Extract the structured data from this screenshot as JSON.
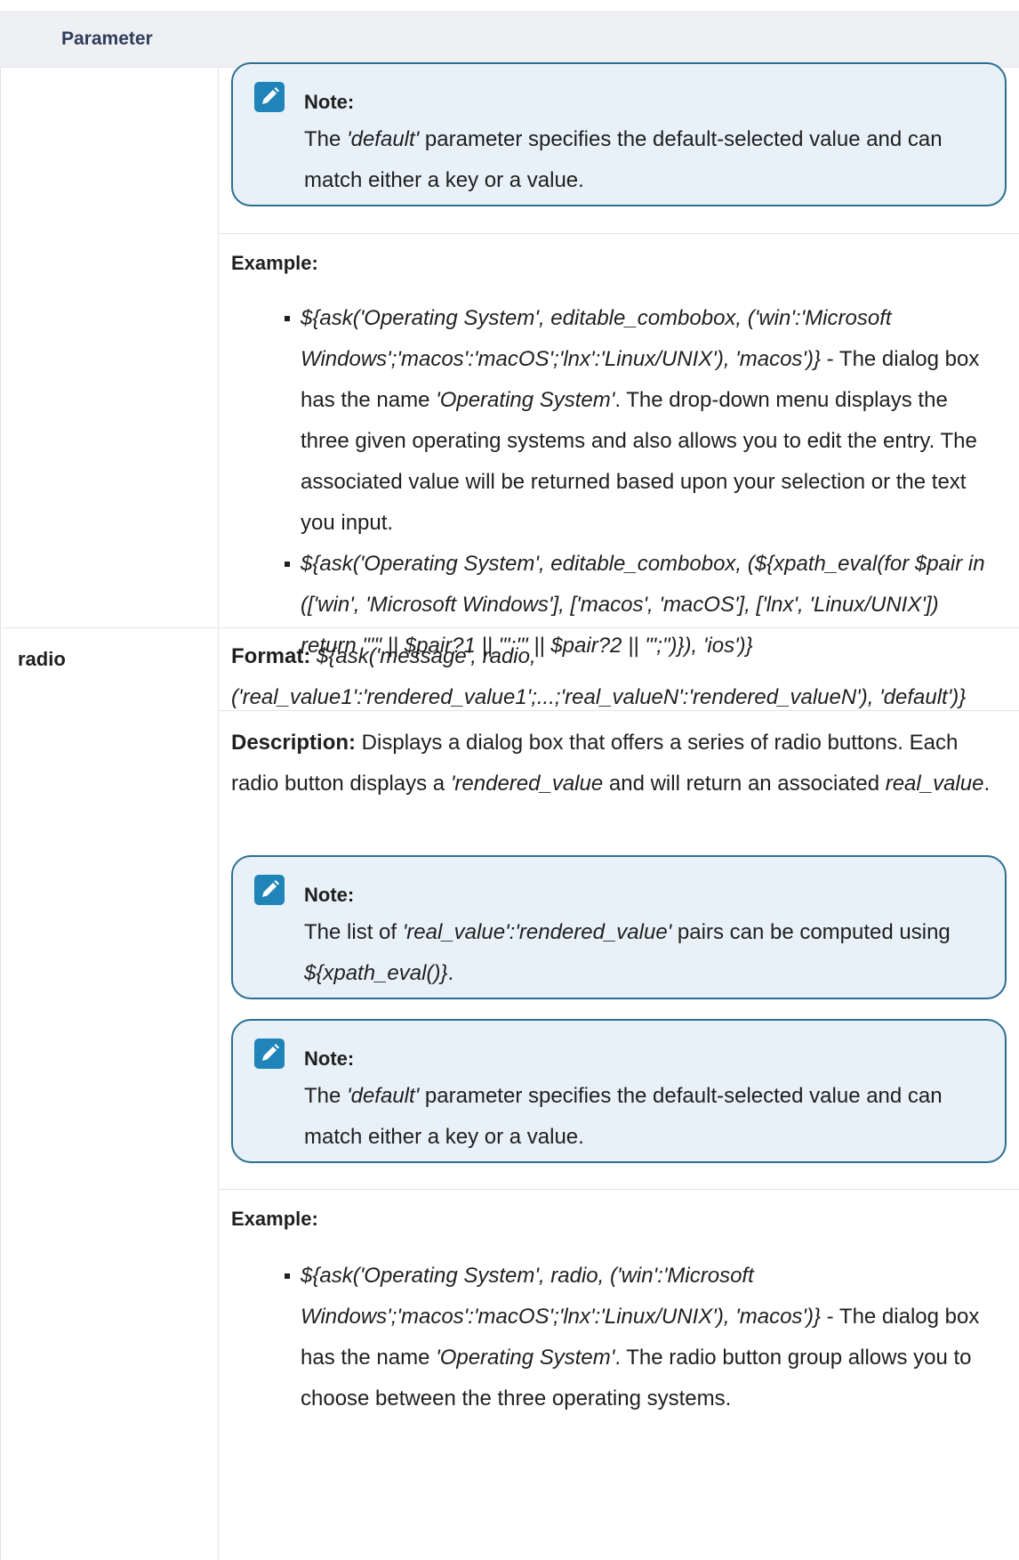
{
  "table": {
    "header": {
      "parameter": "Parameter"
    }
  },
  "note1": {
    "title": "Note:",
    "pre": "The ",
    "em": "'default'",
    "post": " parameter specifies the default-selected value and can match either a key or a value."
  },
  "example1": {
    "label": "Example:",
    "item1": {
      "code": "${ask('Operating System', editable_combobox, ('win':'Microsoft Windows';'macos':'macOS';'lnx':'Linux/UNIX'), 'macos')}",
      "t1": " - The dialog box has the name ",
      "name": "'Operating System'",
      "t2": ". The drop-down menu displays the three given operating systems and also allows you to edit the entry. The associated value will be returned based upon your selection or the text you input."
    },
    "item2": {
      "code": "${ask('Operating System', editable_combobox, (${xpath_eval(for $pair in (['win', 'Microsoft Windows'], ['macos', 'macOS'], ['lnx', 'Linux/UNIX']) return \"'\" || $pair?1 || \"':'\" || $pair?2 || \"';\")}), 'ios')}"
    }
  },
  "radio": {
    "name": "radio",
    "format_label": "Format:",
    "format_value": "${ask('message', radio, ('real_value1':'rendered_value1';...;'real_valueN':'rendered_valueN'), 'default')}",
    "desc_label": "Description:",
    "desc_t1": " Displays a dialog box that offers a series of radio buttons. Each radio button displays a ",
    "desc_em1": "'rendered_value",
    "desc_t2": " and will return an associated ",
    "desc_em2": "real_value",
    "desc_t3": "."
  },
  "note2": {
    "title": "Note:",
    "pre": "The list of ",
    "em": "'real_value':'rendered_value'",
    "mid": " pairs can be computed using ",
    "em2": "${xpath_eval()}",
    "post": "."
  },
  "note3": {
    "title": "Note:",
    "pre": "The ",
    "em": "'default'",
    "post": " parameter specifies the default-selected value and can match either a key or a value."
  },
  "example2": {
    "label": "Example:",
    "item1": {
      "code": "${ask('Operating System', radio, ('win':'Microsoft Windows';'macos':'macOS';'lnx':'Linux/UNIX'), 'macos')}",
      "t1": " - The dialog box has the name ",
      "name": "'Operating System'",
      "t2": ". The radio button group allows you to choose between the three operating systems."
    }
  },
  "colors": {
    "note_border": "#2c6f93",
    "note_bg": "#e8f1f7",
    "icon_bg": "#1f84b8",
    "header_bg": "#eef0f3"
  },
  "icons": [
    "pencil-icon"
  ]
}
